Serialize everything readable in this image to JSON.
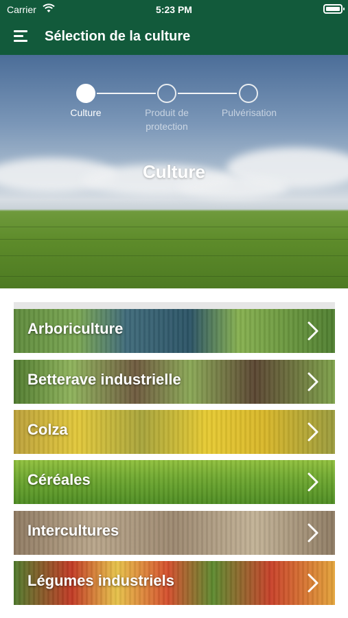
{
  "status_bar": {
    "carrier": "Carrier",
    "time": "5:23 PM"
  },
  "nav": {
    "title": "Sélection de la culture"
  },
  "stepper": {
    "steps": [
      {
        "label": "Culture",
        "active": true
      },
      {
        "label": "Produit de protection",
        "active": false
      },
      {
        "label": "Pulvérisation",
        "active": false
      }
    ]
  },
  "hero": {
    "title": "Culture"
  },
  "crops": [
    {
      "label": "Arboriculture"
    },
    {
      "label": "Betterave industrielle"
    },
    {
      "label": "Colza"
    },
    {
      "label": "Céréales"
    },
    {
      "label": "Intercultures"
    },
    {
      "label": "Légumes industriels"
    }
  ],
  "colors": {
    "brand_green": "#125a3b"
  }
}
